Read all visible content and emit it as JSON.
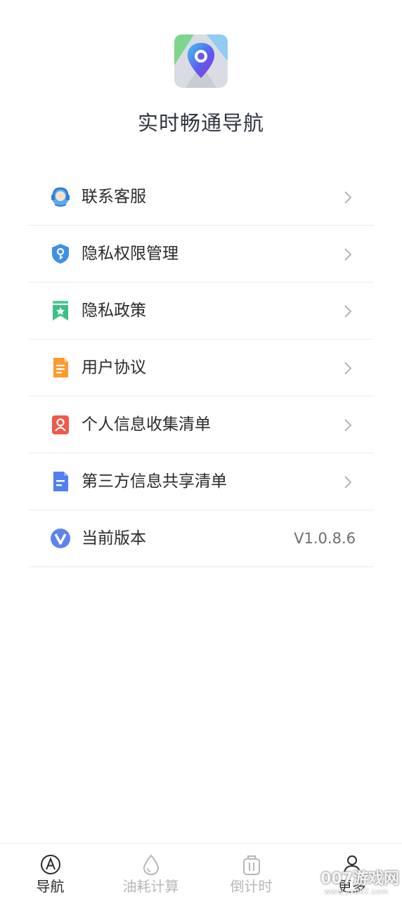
{
  "app": {
    "title": "实时畅通导航"
  },
  "menu": {
    "items": [
      {
        "label": "联系客服",
        "icon": "customer-service-icon"
      },
      {
        "label": "隐私权限管理",
        "icon": "shield-key-icon"
      },
      {
        "label": "隐私政策",
        "icon": "bookmark-star-icon"
      },
      {
        "label": "用户协议",
        "icon": "document-icon"
      },
      {
        "label": "个人信息收集清单",
        "icon": "person-card-icon"
      },
      {
        "label": "第三方信息共享清单",
        "icon": "file-list-icon"
      },
      {
        "label": "当前版本",
        "icon": "version-v-icon",
        "value": "V1.0.8.6"
      }
    ]
  },
  "tabbar": {
    "tabs": [
      {
        "label": "导航",
        "icon": "navigation-icon",
        "active": true
      },
      {
        "label": "油耗计算",
        "icon": "fuel-drop-icon",
        "active": false
      },
      {
        "label": "倒计时",
        "icon": "timer-icon",
        "active": false
      },
      {
        "label": "更多",
        "icon": "person-icon",
        "active": false
      }
    ]
  },
  "watermark": {
    "text": "007游戏网",
    "sub": "www.yx007.com"
  },
  "colors": {
    "title": "#2f3540",
    "text": "#2b2b2b",
    "muted": "#b7b7b7",
    "divider": "#ececec"
  }
}
